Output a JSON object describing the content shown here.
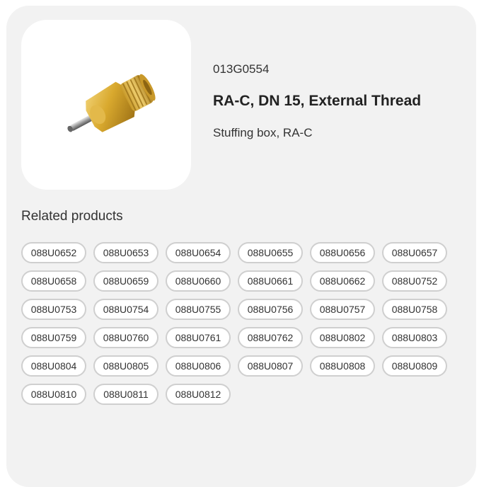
{
  "product": {
    "code": "013G0554",
    "title": "RA-C, DN 15, External Thread",
    "subtitle": "Stuffing box, RA-C",
    "image_icon": "brass-stuffing-box-image"
  },
  "related": {
    "heading": "Related products",
    "items": [
      "088U0652",
      "088U0653",
      "088U0654",
      "088U0655",
      "088U0656",
      "088U0657",
      "088U0658",
      "088U0659",
      "088U0660",
      "088U0661",
      "088U0662",
      "088U0752",
      "088U0753",
      "088U0754",
      "088U0755",
      "088U0756",
      "088U0757",
      "088U0758",
      "088U0759",
      "088U0760",
      "088U0761",
      "088U0762",
      "088U0802",
      "088U0803",
      "088U0804",
      "088U0805",
      "088U0806",
      "088U0807",
      "088U0808",
      "088U0809",
      "088U0810",
      "088U0811",
      "088U0812"
    ]
  },
  "colors": {
    "card_background": "#f2f2f2",
    "chip_border": "#cfcfcf",
    "brass": "#d9a92e"
  }
}
